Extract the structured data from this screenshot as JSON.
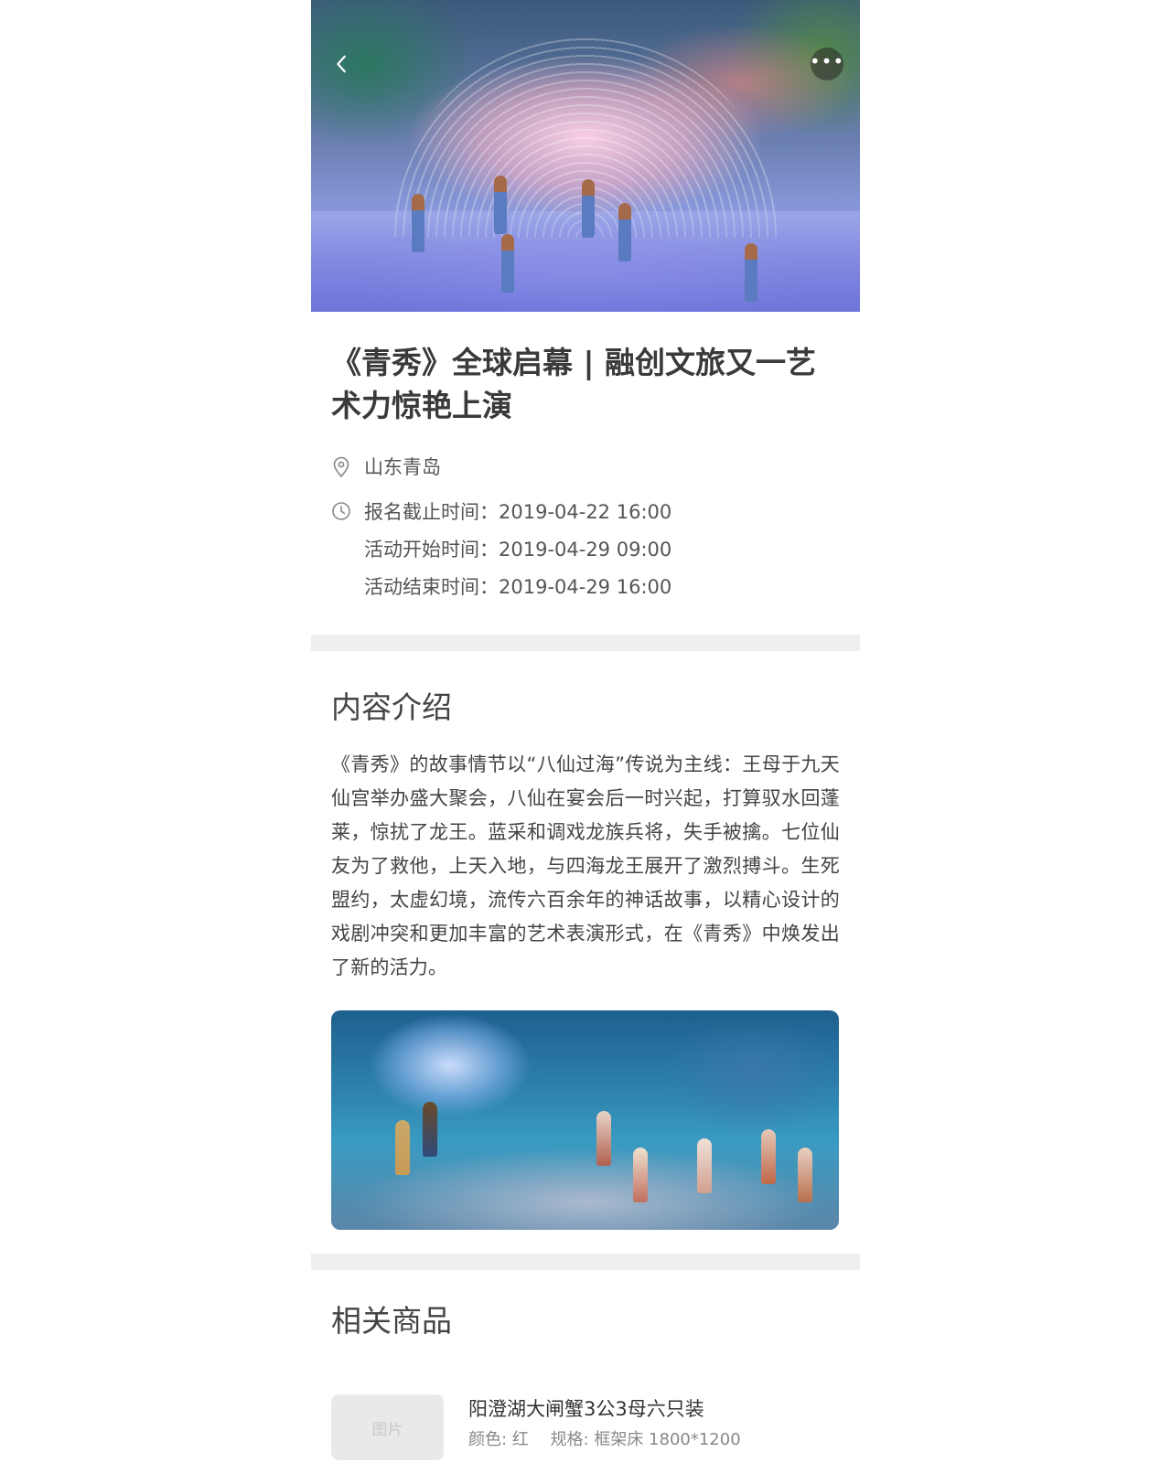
{
  "event": {
    "title": "《青秀》全球启幕 | 融创文旅又一艺术力惊艳上演",
    "location": "山东青岛",
    "times": [
      "报名截止时间：2019-04-22 16:00",
      "活动开始时间：2019-04-29 09:00",
      "活动结束时间：2019-04-29 16:00"
    ]
  },
  "intro": {
    "heading": "内容介绍",
    "text": "《青秀》的故事情节以“八仙过海”传说为主线：王母于九天仙宫举办盛大聚会，八仙在宴会后一时兴起，打算驭水回蓬莱，惊扰了龙王。蓝采和调戏龙族兵将，失手被擒。七位仙友为了救他，上天入地，与四海龙王展开了激烈搏斗。生死盟约，太虚幻境，流传六百余年的神话故事，以精心设计的戏剧冲突和更加丰富的艺术表演形式，在《青秀》中焕发出了新的活力。"
  },
  "products": {
    "heading": "相关商品",
    "items": [
      {
        "thumb_placeholder": "图片",
        "name": "阳澄湖大闸蟹3公3母六只装",
        "color": "颜色: 红",
        "spec": "规格: 框架床 1800*1200"
      }
    ]
  },
  "icons": {
    "back": "chevron-left-icon",
    "more": "more-dots-icon",
    "location": "location-pin-icon",
    "clock": "clock-icon"
  },
  "colors": {
    "divider": "#efefef",
    "thumb_bg": "#e9e9e9",
    "text_primary": "#333333",
    "text_secondary": "#888888"
  }
}
